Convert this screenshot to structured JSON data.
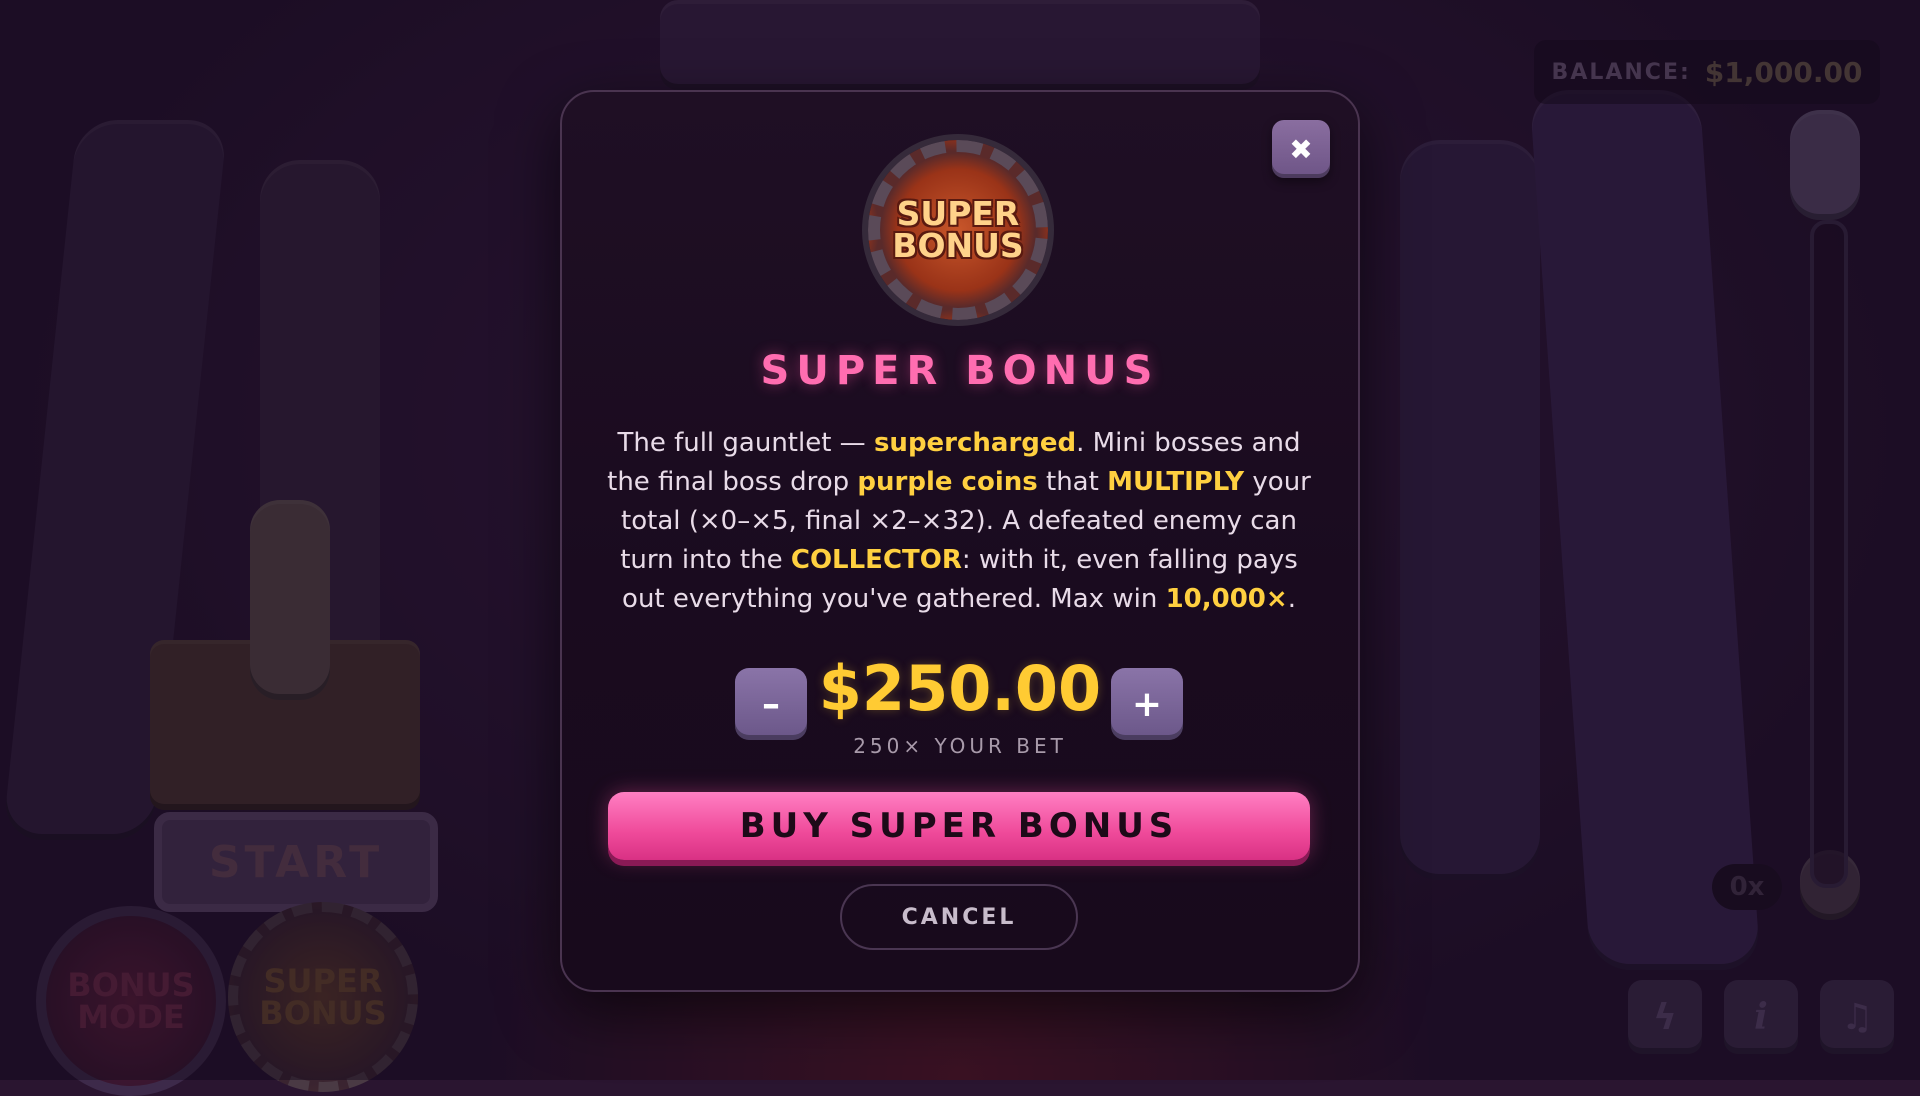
{
  "hud": {
    "balance_label": "BALANCE:",
    "balance_value": "$1,000.00",
    "multiplier": "0x",
    "start_label": "START",
    "bonus_mode_label_1": "BONUS",
    "bonus_mode_label_2": "MODE",
    "super_bonus_label_1": "SUPER",
    "super_bonus_label_2": "BONUS",
    "icons": [
      "lightning-icon",
      "info-icon",
      "music-icon"
    ]
  },
  "modal": {
    "logo_line1": "SUPER",
    "logo_line2": "BONUS",
    "title": "SUPER BONUS",
    "desc": {
      "t1": "The full gauntlet — ",
      "h1": "supercharged",
      "t2": ". Mini bosses and the final boss drop ",
      "h2": "purple coins",
      "t3": " that ",
      "h3": "MULTIPLY",
      "t4": " your total (×0–×5, final ×2–×32). A defeated enemy can turn into the ",
      "h4": "COLLECTOR",
      "t5": ": with it, even falling pays out everything you've gathered. Max win ",
      "h5": "10,000×",
      "t6": "."
    },
    "amount": "$250.00",
    "amount_sub": "250× YOUR BET",
    "decrease_label": "–",
    "increase_label": "+",
    "buy_label": "BUY SUPER BONUS",
    "cancel_label": "CANCEL",
    "close_label": "✖"
  },
  "colors": {
    "accent_pink": "#ff6db0",
    "highlight_gold": "#ffd040",
    "amount_gold": "#ffcb33"
  }
}
